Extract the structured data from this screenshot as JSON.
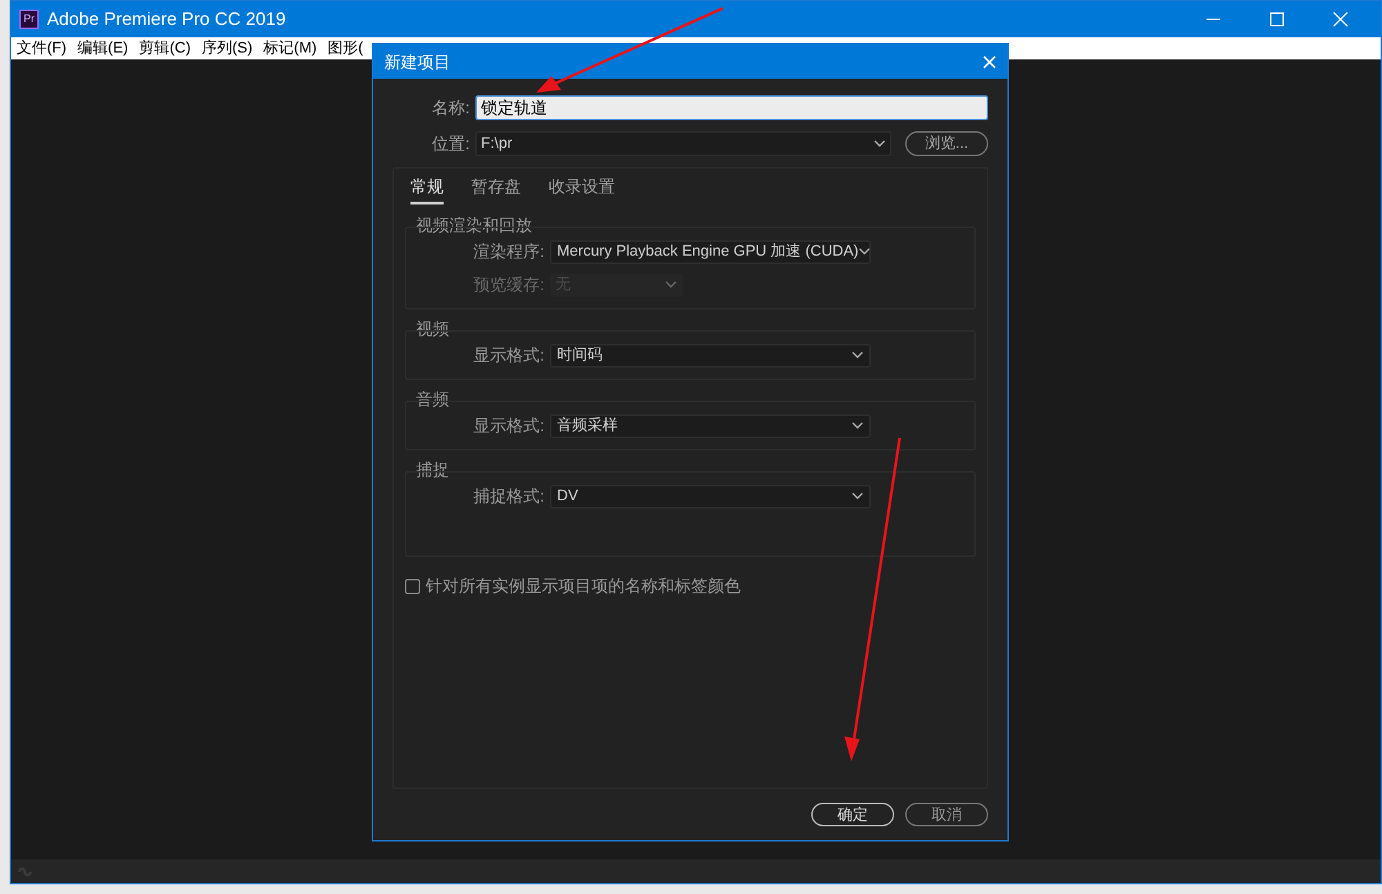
{
  "window": {
    "title": "Adobe Premiere Pro CC 2019",
    "app_icon": "Pr"
  },
  "menu": [
    "文件(F)",
    "编辑(E)",
    "剪辑(C)",
    "序列(S)",
    "标记(M)",
    "图形("
  ],
  "dialog": {
    "title": "新建项目",
    "name": {
      "label": "名称:",
      "value": "锁定轨道"
    },
    "location": {
      "label": "位置:",
      "value": "F:\\pr",
      "browse": "浏览..."
    },
    "tabs": [
      {
        "label": "常规",
        "selected": true
      },
      {
        "label": "暂存盘",
        "selected": false
      },
      {
        "label": "收录设置",
        "selected": false
      }
    ],
    "groups": [
      {
        "title": "视频渲染和回放",
        "fields": [
          {
            "label": "渲染程序:",
            "value": "Mercury Playback Engine GPU 加速 (CUDA)",
            "disabled": false
          },
          {
            "label": "预览缓存:",
            "value": "无",
            "disabled": true
          }
        ]
      },
      {
        "title": "视频",
        "fields": [
          {
            "label": "显示格式:",
            "value": "时间码",
            "disabled": false
          }
        ]
      },
      {
        "title": "音频",
        "fields": [
          {
            "label": "显示格式:",
            "value": "音频采样",
            "disabled": false
          }
        ]
      },
      {
        "title": "捕捉",
        "fields": [
          {
            "label": "捕捉格式:",
            "value": "DV",
            "disabled": false
          }
        ]
      }
    ],
    "checkbox": {
      "label": "针对所有实例显示项目项的名称和标签颜色",
      "checked": false
    },
    "buttons": [
      {
        "label": "确定",
        "disabled": false
      },
      {
        "label": "取消",
        "disabled": false
      }
    ]
  }
}
